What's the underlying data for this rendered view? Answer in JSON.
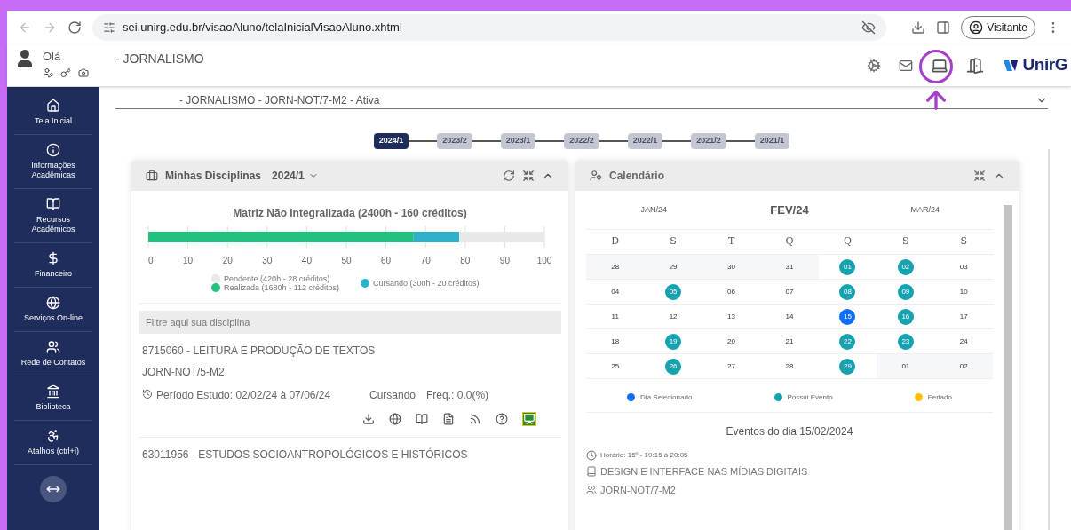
{
  "browser": {
    "url": "sei.unirg.edu.br/visaoAluno/telaInicialVisaoAluno.xhtml",
    "profile": "Visitante"
  },
  "header": {
    "greeting": "Olá",
    "course": "- JORNALISMO",
    "logo": "UnirG"
  },
  "sidebar": {
    "items": [
      {
        "label": "Tela Inicial"
      },
      {
        "label": "Informações Acadêmicas"
      },
      {
        "label": "Recursos Acadêmicos"
      },
      {
        "label": "Financeiro"
      },
      {
        "label": "Serviços On-line"
      },
      {
        "label": "Rede de Contatos"
      },
      {
        "label": "Biblioteca"
      },
      {
        "label": "Atalhos (ctrl+i)"
      }
    ]
  },
  "enrollment": "- JORNALISMO - JORN-NOT/7-M2 - Ativa",
  "periods": [
    {
      "label": "2024/1",
      "selected": true
    },
    {
      "label": "2023/2",
      "selected": false
    },
    {
      "label": "2023/1",
      "selected": false
    },
    {
      "label": "2022/2",
      "selected": false
    },
    {
      "label": "2022/1",
      "selected": false
    },
    {
      "label": "2021/2",
      "selected": false
    },
    {
      "label": "2021/1",
      "selected": false
    }
  ],
  "disciplines": {
    "title": "Minhas Disciplinas",
    "period": "2024/1",
    "chart_data": {
      "type": "bar",
      "orientation": "horizontal",
      "stacked": true,
      "title": "Matriz Não Integralizada (2400h - 160 créditos)",
      "xlim": [
        0,
        100
      ],
      "xticks": [
        0,
        10,
        20,
        30,
        40,
        50,
        60,
        70,
        80,
        90,
        100
      ],
      "grid": true,
      "legend": true,
      "series": [
        {
          "name": "Realizada (1680h - 112 créditos)",
          "color": "#22c17f",
          "values": [
            67
          ]
        },
        {
          "name": "Cursando (300h - 20 créditos)",
          "color": "#2fb2c9",
          "values": [
            11.5
          ]
        },
        {
          "name": "Pendente (420h - 28 créditos)",
          "color": "#e8e8e8",
          "values": [
            21.5
          ]
        }
      ]
    },
    "filter": {
      "placeholder": "Filtre aqui sua disciplina"
    },
    "items": [
      {
        "title": "8715060 - LEITURA E PRODUÇÃO DE TEXTOS",
        "class": "JORN-NOT/5-M2",
        "period": "Período Estudo: 02/02/24 à 07/06/24",
        "status": "Cursando",
        "frequency": "Freq.: 0.0(%)"
      },
      {
        "title": "63011956 - ESTUDOS SOCIOANTROPOLÓGICOS E HISTÓRICOS"
      }
    ]
  },
  "calendar": {
    "title": "Calendário",
    "prev_month": "JAN/24",
    "month": "FEV/24",
    "next_month": "MAR/24",
    "weekdays": [
      "D",
      "S",
      "T",
      "Q",
      "Q",
      "S",
      "S"
    ],
    "weeks": [
      [
        {
          "day": "28",
          "kind": "other"
        },
        {
          "day": "29",
          "kind": "other"
        },
        {
          "day": "30",
          "kind": "other"
        },
        {
          "day": "31",
          "kind": "other"
        },
        {
          "day": "01",
          "kind": "event"
        },
        {
          "day": "02",
          "kind": "event"
        },
        {
          "day": "03",
          "kind": "normal"
        }
      ],
      [
        {
          "day": "04",
          "kind": "normal"
        },
        {
          "day": "05",
          "kind": "event"
        },
        {
          "day": "06",
          "kind": "normal"
        },
        {
          "day": "07",
          "kind": "normal"
        },
        {
          "day": "08",
          "kind": "event"
        },
        {
          "day": "09",
          "kind": "event"
        },
        {
          "day": "10",
          "kind": "normal"
        }
      ],
      [
        {
          "day": "11",
          "kind": "normal"
        },
        {
          "day": "12",
          "kind": "normal"
        },
        {
          "day": "13",
          "kind": "normal"
        },
        {
          "day": "14",
          "kind": "normal"
        },
        {
          "day": "15",
          "kind": "selected"
        },
        {
          "day": "16",
          "kind": "event"
        },
        {
          "day": "17",
          "kind": "normal"
        }
      ],
      [
        {
          "day": "18",
          "kind": "normal"
        },
        {
          "day": "19",
          "kind": "event"
        },
        {
          "day": "20",
          "kind": "normal"
        },
        {
          "day": "21",
          "kind": "normal"
        },
        {
          "day": "22",
          "kind": "event"
        },
        {
          "day": "23",
          "kind": "event"
        },
        {
          "day": "24",
          "kind": "normal"
        }
      ],
      [
        {
          "day": "25",
          "kind": "normal"
        },
        {
          "day": "26",
          "kind": "event"
        },
        {
          "day": "27",
          "kind": "normal"
        },
        {
          "day": "28",
          "kind": "normal"
        },
        {
          "day": "29",
          "kind": "event"
        },
        {
          "day": "01",
          "kind": "other"
        },
        {
          "day": "02",
          "kind": "other"
        }
      ]
    ],
    "legend": [
      {
        "label": "Dia Selecionado",
        "color": "#0d6efd"
      },
      {
        "label": "Possui Evento",
        "color": "#17a2b0"
      },
      {
        "label": "Feriado",
        "color": "#ffc107"
      }
    ],
    "events_title": "Eventos do dia 15/02/2024",
    "event": {
      "time": "Horário: 15º - 19:15 à 20:05",
      "subject": "DESIGN E INTERFACE NAS MÍDIAS DIGITAIS",
      "class": "JORN-NOT/7-M2"
    }
  }
}
